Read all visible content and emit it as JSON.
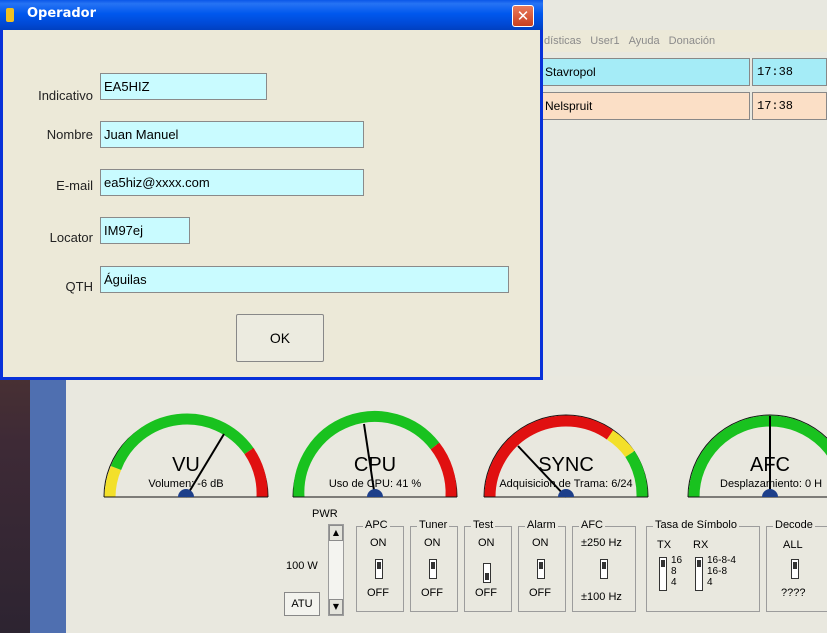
{
  "dialog": {
    "title": "Operador",
    "close_glyph": "✕",
    "fields": {
      "indicativo": {
        "label": "Indicativo",
        "value": "EA5HIZ"
      },
      "nombre": {
        "label": "Nombre",
        "value": "Juan Manuel"
      },
      "email": {
        "label": "E-mail",
        "value": "ea5hiz@xxxx.com"
      },
      "locator": {
        "label": "Locator",
        "value": "IM97ej"
      },
      "qth": {
        "label": "QTH",
        "value": "Águilas"
      }
    },
    "ok_label": "OK"
  },
  "app": {
    "menu": [
      "dísticas",
      "User1",
      "Ayuda",
      "Donación"
    ],
    "rows": [
      {
        "name": "Stavropol",
        "time": "17:38",
        "color": "#a5ecf7"
      },
      {
        "name": "Nelspruit",
        "time": "17:38",
        "color": "#fbdfc6"
      }
    ],
    "gauges": {
      "vu": {
        "title": "VU",
        "caption": "Volumen: -6 dB"
      },
      "cpu": {
        "title": "CPU",
        "caption": "Uso de CPU: 41 %"
      },
      "sync": {
        "title": "SYNC",
        "caption": "Adquisicion de Trama: 6/24"
      },
      "afc": {
        "title": "AFC",
        "caption": "Desplazamiento: 0 H"
      }
    },
    "controls": {
      "pwr_label": "PWR",
      "power_value": "100 W",
      "atu_label": "ATU",
      "apc": {
        "title": "APC",
        "on": "ON",
        "off": "OFF"
      },
      "tuner": {
        "title": "Tuner",
        "on": "ON",
        "off": "OFF"
      },
      "test": {
        "title": "Test",
        "on": "ON",
        "off": "OFF"
      },
      "alarm": {
        "title": "Alarm",
        "on": "ON",
        "off": "OFF"
      },
      "afc": {
        "title": "AFC",
        "on": "±250 Hz",
        "off": "±100 Hz"
      },
      "simbolo": {
        "title": "Tasa de Símbolo",
        "tx": "TX",
        "rx": "RX",
        "tx_16": "16",
        "tx_8": "8",
        "tx_4": "4",
        "rx_1684": "16-8-4",
        "rx_168": "16-8",
        "rx_4": "4"
      },
      "decode": {
        "title": "Decode",
        "on": "ALL",
        "off": "????"
      }
    }
  },
  "colors": {
    "titlebar": "#0058ee",
    "input_bg": "#c9fbff",
    "gauge_green": "#19c21f",
    "gauge_red": "#e01010",
    "gauge_yellow": "#f3e02a"
  }
}
